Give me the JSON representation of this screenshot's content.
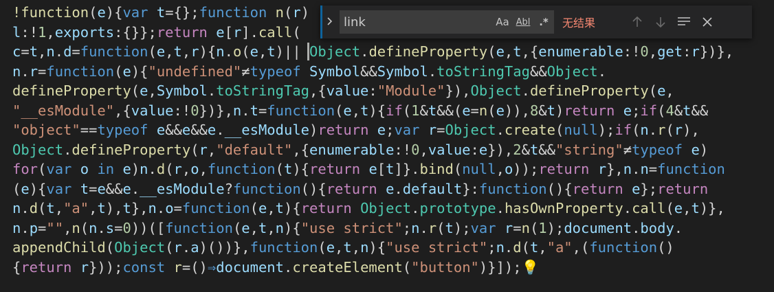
{
  "find_widget": {
    "toggle_replace_icon": "chevron-right-icon",
    "search_value": "link",
    "match_case_label": "Aa",
    "whole_word_label": "Abl",
    "regex_label": ".*",
    "result_text": "无结果",
    "prev_match_icon": "arrow-up-icon",
    "next_match_icon": "arrow-down-icon",
    "find_in_selection_icon": "selection-icon",
    "close_icon": "close-icon",
    "result_color": "#f48771"
  },
  "code_lines": [
    [
      [
        "fn",
        "!function"
      ],
      [
        "pun",
        "("
      ],
      [
        "var",
        "e"
      ],
      [
        "pun",
        "){"
      ],
      [
        "kw",
        "var"
      ],
      [
        "pun",
        " "
      ],
      [
        "var",
        "t"
      ],
      [
        "pun",
        "={};"
      ],
      [
        "kw",
        "function"
      ],
      [
        "pun",
        " "
      ],
      [
        "fn",
        "n"
      ],
      [
        "pun",
        "("
      ],
      [
        "var",
        "r"
      ],
      [
        "pun",
        ")"
      ]
    ],
    [
      [
        "var",
        "l"
      ],
      [
        "pun",
        ":"
      ],
      [
        "op",
        "!"
      ],
      [
        "num",
        "1"
      ],
      [
        "pun",
        ","
      ],
      [
        "var",
        "exports"
      ],
      [
        "pun",
        ":{}};"
      ],
      [
        "ctl",
        "return"
      ],
      [
        "pun",
        " "
      ],
      [
        "var",
        "e"
      ],
      [
        "pun",
        "["
      ],
      [
        "var",
        "r"
      ],
      [
        "pun",
        "]."
      ],
      [
        "fn",
        "call"
      ],
      [
        "pun",
        "("
      ]
    ],
    [
      [
        "var",
        "c"
      ],
      [
        "pun",
        "="
      ],
      [
        "var",
        "t"
      ],
      [
        "pun",
        ","
      ],
      [
        "var",
        "n"
      ],
      [
        "pun",
        "."
      ],
      [
        "var",
        "d"
      ],
      [
        "pun",
        "="
      ],
      [
        "kw",
        "function"
      ],
      [
        "pun",
        "("
      ],
      [
        "var",
        "e"
      ],
      [
        "pun",
        ","
      ],
      [
        "var",
        "t"
      ],
      [
        "pun",
        ","
      ],
      [
        "var",
        "r"
      ],
      [
        "pun",
        "){"
      ],
      [
        "var",
        "n"
      ],
      [
        "pun",
        "."
      ],
      [
        "fn",
        "o"
      ],
      [
        "pun",
        "("
      ],
      [
        "var",
        "e"
      ],
      [
        "pun",
        ","
      ],
      [
        "var",
        "t"
      ],
      [
        "pun",
        ")|| "
      ],
      [
        "cls",
        "Object"
      ],
      [
        "pun",
        "."
      ],
      [
        "fn",
        "defineProperty"
      ],
      [
        "pun",
        "("
      ],
      [
        "var",
        "e"
      ],
      [
        "pun",
        ","
      ],
      [
        "var",
        "t"
      ],
      [
        "pun",
        ",{"
      ],
      [
        "var",
        "enumerable"
      ],
      [
        "pun",
        ":"
      ],
      [
        "op",
        "!"
      ],
      [
        "num",
        "0"
      ],
      [
        "pun",
        ","
      ],
      [
        "var",
        "get"
      ],
      [
        "pun",
        ":"
      ],
      [
        "var",
        "r"
      ],
      [
        "pun",
        "})},"
      ]
    ],
    [
      [
        "var",
        "n"
      ],
      [
        "pun",
        "."
      ],
      [
        "var",
        "r"
      ],
      [
        "pun",
        "="
      ],
      [
        "kw",
        "function"
      ],
      [
        "pun",
        "("
      ],
      [
        "var",
        "e"
      ],
      [
        "pun",
        "){"
      ],
      [
        "str",
        "\"undefined\""
      ],
      [
        "op",
        "≠"
      ],
      [
        "kw",
        "typeof"
      ],
      [
        "pun",
        " "
      ],
      [
        "var",
        "Symbol"
      ],
      [
        "op",
        "&&"
      ],
      [
        "var",
        "Symbol"
      ],
      [
        "pun",
        "."
      ],
      [
        "cls",
        "toStringTag"
      ],
      [
        "op",
        "&&"
      ],
      [
        "cls",
        "Object"
      ],
      [
        "pun",
        "."
      ]
    ],
    [
      [
        "fn",
        "defineProperty"
      ],
      [
        "pun",
        "("
      ],
      [
        "var",
        "e"
      ],
      [
        "pun",
        ","
      ],
      [
        "var",
        "Symbol"
      ],
      [
        "pun",
        "."
      ],
      [
        "cls",
        "toStringTag"
      ],
      [
        "pun",
        ",{"
      ],
      [
        "var",
        "value"
      ],
      [
        "pun",
        ":"
      ],
      [
        "str",
        "\"Module\""
      ],
      [
        "pun",
        "}),"
      ],
      [
        "cls",
        "Object"
      ],
      [
        "pun",
        "."
      ],
      [
        "fn",
        "defineProperty"
      ],
      [
        "pun",
        "("
      ],
      [
        "var",
        "e"
      ],
      [
        "pun",
        ","
      ]
    ],
    [
      [
        "str",
        "\"__esModule\""
      ],
      [
        "pun",
        ",{"
      ],
      [
        "var",
        "value"
      ],
      [
        "pun",
        ":"
      ],
      [
        "op",
        "!"
      ],
      [
        "num",
        "0"
      ],
      [
        "pun",
        "})},"
      ],
      [
        "var",
        "n"
      ],
      [
        "pun",
        "."
      ],
      [
        "var",
        "t"
      ],
      [
        "pun",
        "="
      ],
      [
        "kw",
        "function"
      ],
      [
        "pun",
        "("
      ],
      [
        "var",
        "e"
      ],
      [
        "pun",
        ","
      ],
      [
        "var",
        "t"
      ],
      [
        "pun",
        "){"
      ],
      [
        "ctl",
        "if"
      ],
      [
        "pun",
        "("
      ],
      [
        "num",
        "1"
      ],
      [
        "op",
        "&"
      ],
      [
        "var",
        "t"
      ],
      [
        "op",
        "&&"
      ],
      [
        "pun",
        "("
      ],
      [
        "var",
        "e"
      ],
      [
        "pun",
        "="
      ],
      [
        "fn",
        "n"
      ],
      [
        "pun",
        "("
      ],
      [
        "var",
        "e"
      ],
      [
        "pun",
        ")),"
      ],
      [
        "num",
        "8"
      ],
      [
        "op",
        "&"
      ],
      [
        "var",
        "t"
      ],
      [
        "pun",
        ")"
      ],
      [
        "ctl",
        "return"
      ],
      [
        "pun",
        " "
      ],
      [
        "var",
        "e"
      ],
      [
        "pun",
        ";"
      ],
      [
        "ctl",
        "if"
      ],
      [
        "pun",
        "("
      ],
      [
        "num",
        "4"
      ],
      [
        "op",
        "&"
      ],
      [
        "var",
        "t"
      ],
      [
        "op",
        "&&"
      ]
    ],
    [
      [
        "str",
        "\"object\""
      ],
      [
        "op",
        "=="
      ],
      [
        "kw",
        "typeof"
      ],
      [
        "pun",
        " "
      ],
      [
        "var",
        "e"
      ],
      [
        "op",
        "&&"
      ],
      [
        "var",
        "e"
      ],
      [
        "op",
        "&&"
      ],
      [
        "var",
        "e"
      ],
      [
        "pun",
        "."
      ],
      [
        "var",
        "__esModule"
      ],
      [
        "pun",
        ")"
      ],
      [
        "ctl",
        "return"
      ],
      [
        "pun",
        " "
      ],
      [
        "var",
        "e"
      ],
      [
        "pun",
        ";"
      ],
      [
        "kw",
        "var"
      ],
      [
        "pun",
        " "
      ],
      [
        "var",
        "r"
      ],
      [
        "pun",
        "="
      ],
      [
        "cls",
        "Object"
      ],
      [
        "pun",
        "."
      ],
      [
        "fn",
        "create"
      ],
      [
        "pun",
        "("
      ],
      [
        "kw",
        "null"
      ],
      [
        "pun",
        ");"
      ],
      [
        "ctl",
        "if"
      ],
      [
        "pun",
        "("
      ],
      [
        "var",
        "n"
      ],
      [
        "pun",
        "."
      ],
      [
        "fn",
        "r"
      ],
      [
        "pun",
        "("
      ],
      [
        "var",
        "r"
      ],
      [
        "pun",
        "),"
      ]
    ],
    [
      [
        "cls",
        "Object"
      ],
      [
        "pun",
        "."
      ],
      [
        "fn",
        "defineProperty"
      ],
      [
        "pun",
        "("
      ],
      [
        "var",
        "r"
      ],
      [
        "pun",
        ","
      ],
      [
        "str",
        "\"default\""
      ],
      [
        "pun",
        ",{"
      ],
      [
        "var",
        "enumerable"
      ],
      [
        "pun",
        ":"
      ],
      [
        "op",
        "!"
      ],
      [
        "num",
        "0"
      ],
      [
        "pun",
        ","
      ],
      [
        "var",
        "value"
      ],
      [
        "pun",
        ":"
      ],
      [
        "var",
        "e"
      ],
      [
        "pun",
        "}),"
      ],
      [
        "num",
        "2"
      ],
      [
        "op",
        "&"
      ],
      [
        "var",
        "t"
      ],
      [
        "op",
        "&&"
      ],
      [
        "str",
        "\"string\""
      ],
      [
        "op",
        "≠"
      ],
      [
        "kw",
        "typeof"
      ],
      [
        "pun",
        " "
      ],
      [
        "var",
        "e"
      ],
      [
        "pun",
        ")"
      ]
    ],
    [
      [
        "ctl",
        "for"
      ],
      [
        "pun",
        "("
      ],
      [
        "kw",
        "var"
      ],
      [
        "pun",
        " "
      ],
      [
        "var",
        "o"
      ],
      [
        "pun",
        " "
      ],
      [
        "kw",
        "in"
      ],
      [
        "pun",
        " "
      ],
      [
        "var",
        "e"
      ],
      [
        "pun",
        ")"
      ],
      [
        "var",
        "n"
      ],
      [
        "pun",
        "."
      ],
      [
        "fn",
        "d"
      ],
      [
        "pun",
        "("
      ],
      [
        "var",
        "r"
      ],
      [
        "pun",
        ","
      ],
      [
        "var",
        "o"
      ],
      [
        "pun",
        ","
      ],
      [
        "kw",
        "function"
      ],
      [
        "pun",
        "("
      ],
      [
        "var",
        "t"
      ],
      [
        "pun",
        "){"
      ],
      [
        "ctl",
        "return"
      ],
      [
        "pun",
        " "
      ],
      [
        "var",
        "e"
      ],
      [
        "pun",
        "["
      ],
      [
        "var",
        "t"
      ],
      [
        "pun",
        "]}."
      ],
      [
        "fn",
        "bind"
      ],
      [
        "pun",
        "("
      ],
      [
        "kw",
        "null"
      ],
      [
        "pun",
        ","
      ],
      [
        "var",
        "o"
      ],
      [
        "pun",
        "));"
      ],
      [
        "ctl",
        "return"
      ],
      [
        "pun",
        " "
      ],
      [
        "var",
        "r"
      ],
      [
        "pun",
        "},"
      ],
      [
        "var",
        "n"
      ],
      [
        "pun",
        "."
      ],
      [
        "var",
        "n"
      ],
      [
        "pun",
        "="
      ],
      [
        "kw",
        "function"
      ]
    ],
    [
      [
        "pun",
        "("
      ],
      [
        "var",
        "e"
      ],
      [
        "pun",
        "){"
      ],
      [
        "kw",
        "var"
      ],
      [
        "pun",
        " "
      ],
      [
        "var",
        "t"
      ],
      [
        "pun",
        "="
      ],
      [
        "var",
        "e"
      ],
      [
        "op",
        "&&"
      ],
      [
        "var",
        "e"
      ],
      [
        "pun",
        "."
      ],
      [
        "var",
        "__esModule"
      ],
      [
        "pun",
        "?"
      ],
      [
        "kw",
        "function"
      ],
      [
        "pun",
        "(){"
      ],
      [
        "ctl",
        "return"
      ],
      [
        "pun",
        " "
      ],
      [
        "var",
        "e"
      ],
      [
        "pun",
        "."
      ],
      [
        "var",
        "default"
      ],
      [
        "pun",
        "}:"
      ],
      [
        "kw",
        "function"
      ],
      [
        "pun",
        "(){"
      ],
      [
        "ctl",
        "return"
      ],
      [
        "pun",
        " "
      ],
      [
        "var",
        "e"
      ],
      [
        "pun",
        "};"
      ],
      [
        "ctl",
        "return"
      ]
    ],
    [
      [
        "var",
        "n"
      ],
      [
        "pun",
        "."
      ],
      [
        "fn",
        "d"
      ],
      [
        "pun",
        "("
      ],
      [
        "var",
        "t"
      ],
      [
        "pun",
        ","
      ],
      [
        "str",
        "\"a\""
      ],
      [
        "pun",
        ","
      ],
      [
        "var",
        "t"
      ],
      [
        "pun",
        "),"
      ],
      [
        "var",
        "t"
      ],
      [
        "pun",
        "},"
      ],
      [
        "var",
        "n"
      ],
      [
        "pun",
        "."
      ],
      [
        "var",
        "o"
      ],
      [
        "pun",
        "="
      ],
      [
        "kw",
        "function"
      ],
      [
        "pun",
        "("
      ],
      [
        "var",
        "e"
      ],
      [
        "pun",
        ","
      ],
      [
        "var",
        "t"
      ],
      [
        "pun",
        "){"
      ],
      [
        "ctl",
        "return"
      ],
      [
        "pun",
        " "
      ],
      [
        "cls",
        "Object"
      ],
      [
        "pun",
        "."
      ],
      [
        "cls",
        "prototype"
      ],
      [
        "pun",
        "."
      ],
      [
        "fn",
        "hasOwnProperty"
      ],
      [
        "pun",
        "."
      ],
      [
        "fn",
        "call"
      ],
      [
        "pun",
        "("
      ],
      [
        "var",
        "e"
      ],
      [
        "pun",
        ","
      ],
      [
        "var",
        "t"
      ],
      [
        "pun",
        ")},"
      ]
    ],
    [
      [
        "var",
        "n"
      ],
      [
        "pun",
        "."
      ],
      [
        "var",
        "p"
      ],
      [
        "pun",
        "="
      ],
      [
        "str",
        "\"\""
      ],
      [
        "pun",
        ","
      ],
      [
        "fn",
        "n"
      ],
      [
        "pun",
        "("
      ],
      [
        "var",
        "n"
      ],
      [
        "pun",
        "."
      ],
      [
        "var",
        "s"
      ],
      [
        "pun",
        "="
      ],
      [
        "num",
        "0"
      ],
      [
        "pun",
        "))(["
      ],
      [
        "kw",
        "function"
      ],
      [
        "pun",
        "("
      ],
      [
        "var",
        "e"
      ],
      [
        "pun",
        ","
      ],
      [
        "var",
        "t"
      ],
      [
        "pun",
        ","
      ],
      [
        "var",
        "n"
      ],
      [
        "pun",
        "){"
      ],
      [
        "str",
        "\"use strict\""
      ],
      [
        "pun",
        ";"
      ],
      [
        "var",
        "n"
      ],
      [
        "pun",
        "."
      ],
      [
        "fn",
        "r"
      ],
      [
        "pun",
        "("
      ],
      [
        "var",
        "t"
      ],
      [
        "pun",
        ");"
      ],
      [
        "kw",
        "var"
      ],
      [
        "pun",
        " "
      ],
      [
        "var",
        "r"
      ],
      [
        "pun",
        "="
      ],
      [
        "fn",
        "n"
      ],
      [
        "pun",
        "("
      ],
      [
        "num",
        "1"
      ],
      [
        "pun",
        ");"
      ],
      [
        "var",
        "document"
      ],
      [
        "pun",
        "."
      ],
      [
        "var",
        "body"
      ],
      [
        "pun",
        "."
      ]
    ],
    [
      [
        "fn",
        "appendChild"
      ],
      [
        "pun",
        "("
      ],
      [
        "cls",
        "Object"
      ],
      [
        "pun",
        "("
      ],
      [
        "var",
        "r"
      ],
      [
        "pun",
        "."
      ],
      [
        "var",
        "a"
      ],
      [
        "pun",
        ")())},"
      ],
      [
        "kw",
        "function"
      ],
      [
        "pun",
        "("
      ],
      [
        "var",
        "e"
      ],
      [
        "pun",
        ","
      ],
      [
        "var",
        "t"
      ],
      [
        "pun",
        ","
      ],
      [
        "var",
        "n"
      ],
      [
        "pun",
        "){"
      ],
      [
        "str",
        "\"use strict\""
      ],
      [
        "pun",
        ";"
      ],
      [
        "var",
        "n"
      ],
      [
        "pun",
        "."
      ],
      [
        "fn",
        "d"
      ],
      [
        "pun",
        "("
      ],
      [
        "var",
        "t"
      ],
      [
        "pun",
        ","
      ],
      [
        "str",
        "\"a\""
      ],
      [
        "pun",
        ",("
      ],
      [
        "kw",
        "function"
      ],
      [
        "pun",
        "()"
      ]
    ],
    [
      [
        "pun",
        "{"
      ],
      [
        "ctl",
        "return"
      ],
      [
        "pun",
        " "
      ],
      [
        "var",
        "r"
      ],
      [
        "pun",
        "}));"
      ],
      [
        "kw",
        "const"
      ],
      [
        "pun",
        " "
      ],
      [
        "fn",
        "r"
      ],
      [
        "pun",
        "=()"
      ],
      [
        "kw",
        "⇒"
      ],
      [
        "var",
        "document"
      ],
      [
        "pun",
        "."
      ],
      [
        "fn",
        "createElement"
      ],
      [
        "pun",
        "("
      ],
      [
        "str",
        "\"button\""
      ],
      [
        "pun",
        ")}]);"
      ],
      [
        "bulb",
        "💡"
      ]
    ]
  ]
}
